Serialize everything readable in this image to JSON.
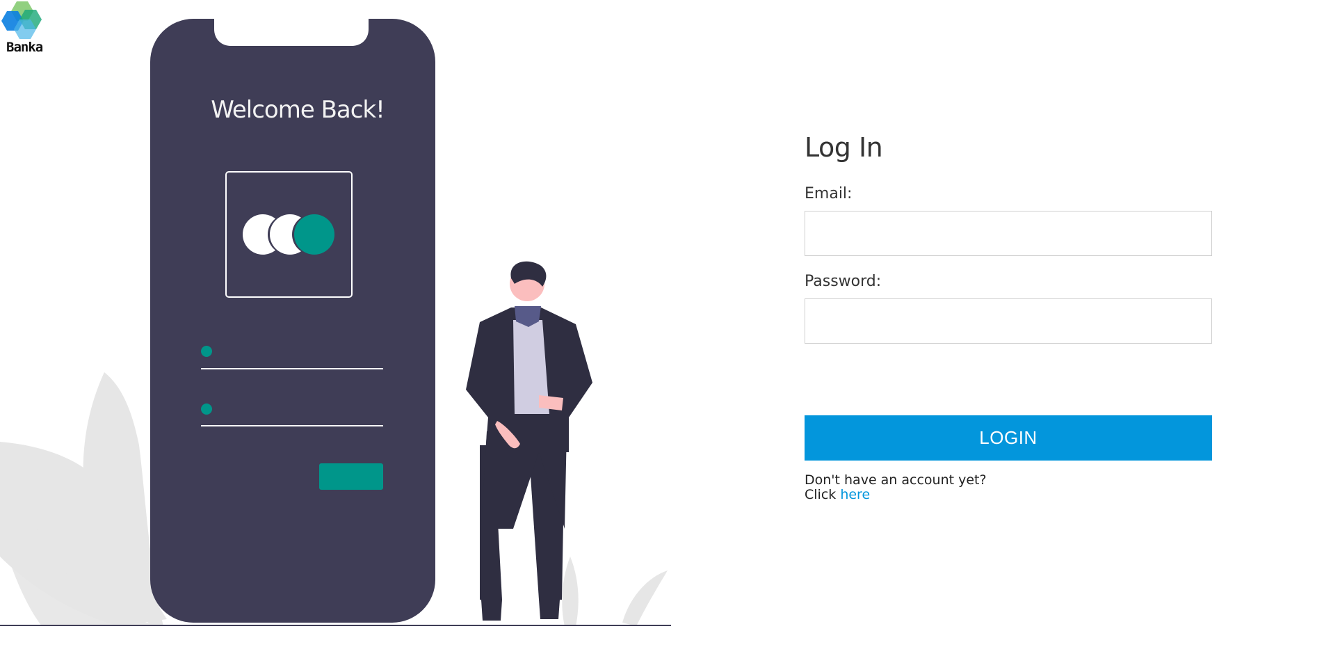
{
  "brand": {
    "name": "Banka"
  },
  "illustration": {
    "welcome_text": "Welcome Back!"
  },
  "login_form": {
    "title": "Log In",
    "email_label": "Email:",
    "email_value": "",
    "email_placeholder": "",
    "password_label": "Password:",
    "password_value": "",
    "password_placeholder": "",
    "submit_label": "LOGIN",
    "signup_prompt": "Don't have an account yet?",
    "signup_click": "Click",
    "signup_link": "here"
  },
  "colors": {
    "accent": "#0396dc",
    "phone_body": "#3f3d56",
    "teal": "#00968a",
    "leaf_gray": "#e6e6e6"
  },
  "icons": [
    "logo-hexagon-icon",
    "user-avatar-icon"
  ]
}
